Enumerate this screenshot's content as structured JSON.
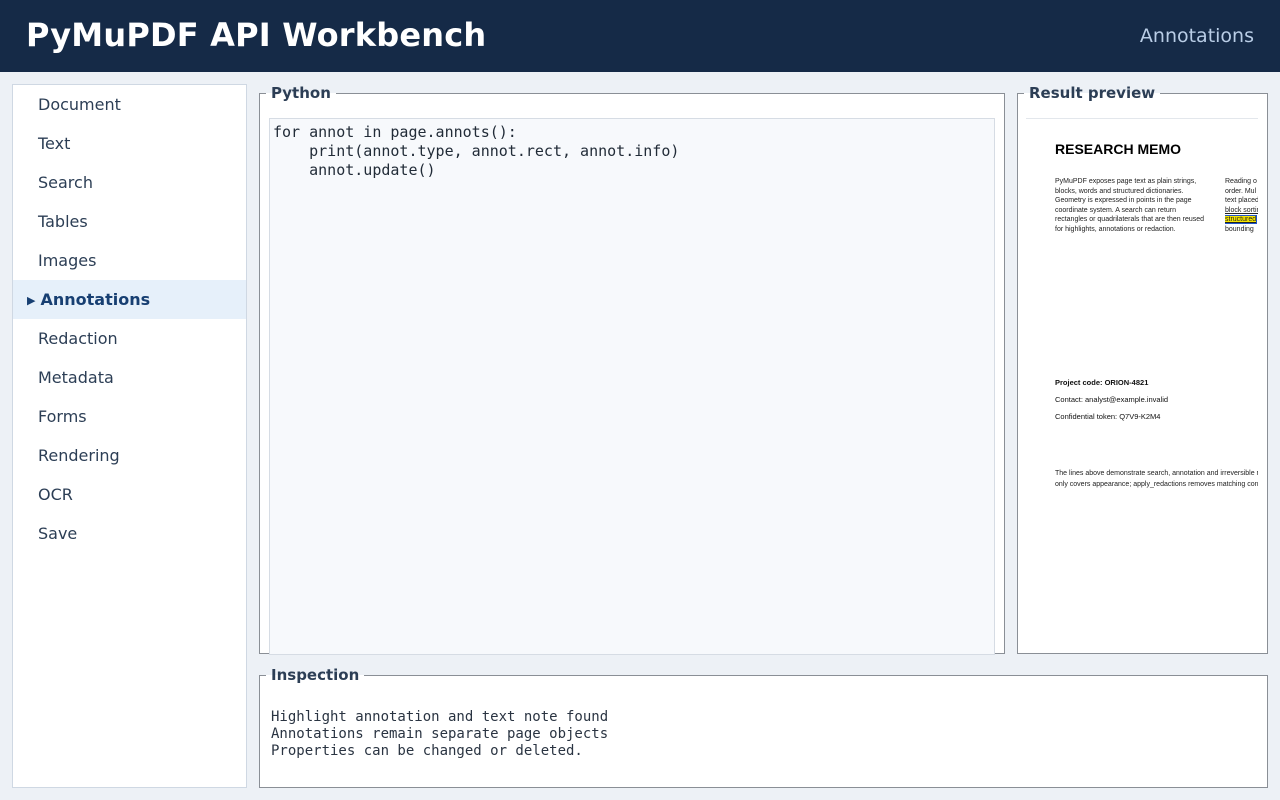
{
  "header": {
    "app_title": "PyMuPDF API Workbench",
    "section": "Annotations"
  },
  "sidebar": {
    "items": [
      {
        "label": "Document"
      },
      {
        "label": "Text"
      },
      {
        "label": "Search"
      },
      {
        "label": "Tables"
      },
      {
        "label": "Images"
      },
      {
        "label": "Annotations",
        "active": true
      },
      {
        "label": "Redaction"
      },
      {
        "label": "Metadata"
      },
      {
        "label": "Forms"
      },
      {
        "label": "Rendering"
      },
      {
        "label": "OCR"
      },
      {
        "label": "Save"
      }
    ]
  },
  "code_panel": {
    "title": "Python",
    "code": "for annot in page.annots():\n    print(annot.type, annot.rect, annot.info)\n    annot.update()"
  },
  "preview_panel": {
    "title": "Result preview",
    "document": {
      "heading": "RESEARCH MEMO",
      "column1": [
        "PyMuPDF exposes page text as plain strings,",
        "blocks, words and structured dictionaries.",
        "Geometry is expressed in points in the page",
        "coordinate system. A search can return",
        "rectangles or quadrilaterals that are then reused",
        "for highlights, annotations or redaction."
      ],
      "column2": [
        "Reading o",
        "order. Mul",
        "text placed",
        "block sortin",
        "structured",
        "bounding"
      ],
      "project_code": "Project code: ORION-4821",
      "contact": "Contact: analyst@example.invalid",
      "token": "Confidential token: Q7V9-K2M4",
      "footer_line1": "The lines above demonstrate search, annotation and irreversible r",
      "footer_line2": "only covers appearance; apply_redactions removes matching con"
    }
  },
  "inspection": {
    "title": "Inspection",
    "output": "Highlight annotation and text note found\nAnnotations remain separate page objects\nProperties can be changed or deleted."
  },
  "colors": {
    "header_bg": "#152a47",
    "active_nav_bg": "#e6f0fa",
    "active_nav_text": "#173f72",
    "highlight": "#f5e600",
    "highlight_border": "#1f55c8"
  }
}
